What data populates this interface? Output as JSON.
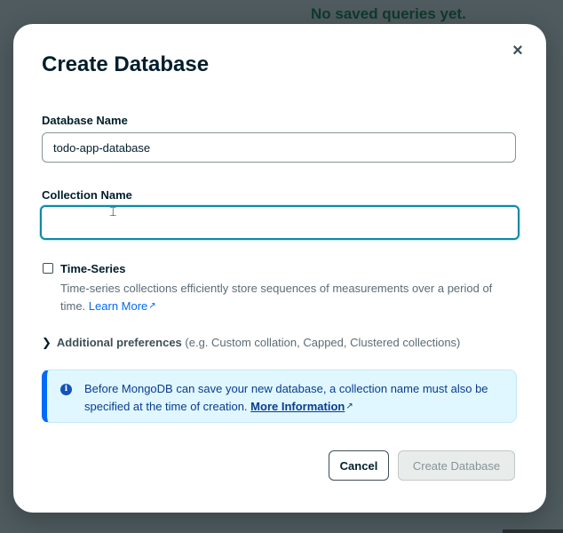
{
  "background": {
    "empty_state_text": "No saved queries yet."
  },
  "modal": {
    "title": "Create Database",
    "close_icon": "close-icon",
    "database_name": {
      "label": "Database Name",
      "value": "todo-app-database"
    },
    "collection_name": {
      "label": "Collection Name",
      "value": ""
    },
    "time_series": {
      "label": "Time-Series",
      "checked": false,
      "description": "Time-series collections efficiently store sequences of measurements over a period of time.",
      "link": "Learn More",
      "link_icon": "external-link-icon"
    },
    "additional_preferences": {
      "title": "Additional preferences",
      "hint": "(e.g. Custom collation, Capped, Clustered collections)",
      "icon": "chevron-right-icon"
    },
    "info_banner": {
      "icon": "info-icon",
      "text": "Before MongoDB can save your new database, a collection name must also be specified at the time of creation.",
      "link": "More Information",
      "link_icon": "external-link-icon"
    },
    "buttons": {
      "cancel": "Cancel",
      "create": "Create Database"
    }
  },
  "colors": {
    "primary_link": "#016bf8",
    "focus_border": "#0c8aa6",
    "banner_bg": "#e1f7ff",
    "banner_accent": "#016bf8",
    "disabled_button_bg": "#e8edeb"
  }
}
